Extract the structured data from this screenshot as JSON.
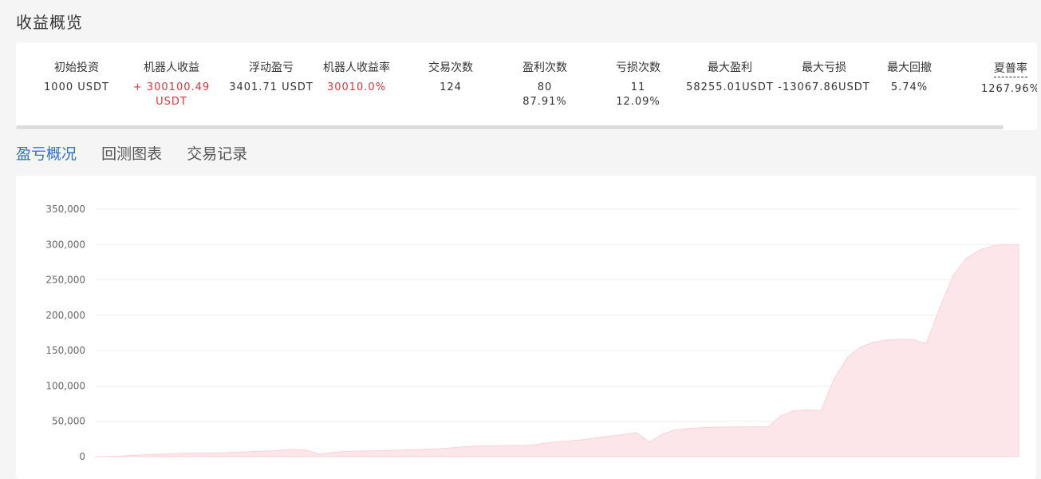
{
  "page": {
    "title": "收益概览"
  },
  "stats": [
    {
      "label": "初始投资",
      "lines": [
        "1000 USDT"
      ],
      "red": false
    },
    {
      "label": "机器人收益",
      "lines": [
        "+ 300100.49",
        "USDT"
      ],
      "red": true
    },
    {
      "label": "浮动盈亏",
      "lines": [
        "3401.71 USDT"
      ],
      "red": false
    },
    {
      "label": "机器人收益率",
      "lines": [
        "30010.0%"
      ],
      "red": true
    },
    {
      "label": "交易次数",
      "lines": [
        "124"
      ],
      "red": false
    },
    {
      "label": "盈利次数",
      "lines": [
        "80",
        "87.91%"
      ],
      "red": false
    },
    {
      "label": "亏损次数",
      "lines": [
        "11",
        "12.09%"
      ],
      "red": false
    },
    {
      "label": "最大盈利",
      "lines": [
        "58255.01USDT"
      ],
      "red": false
    },
    {
      "label": "最大亏损",
      "lines": [
        "-13067.86USDT"
      ],
      "red": false
    },
    {
      "label": "最大回撤",
      "lines": [
        "5.74%"
      ],
      "red": false
    },
    {
      "label": "夏普率",
      "lines": [
        "1267.96%"
      ],
      "red": false
    }
  ],
  "tabs": [
    {
      "label": "盈亏概况",
      "active": true
    },
    {
      "label": "回测图表",
      "active": false
    },
    {
      "label": "交易记录",
      "active": false
    }
  ],
  "colors": {
    "accent": "#2d6fd6",
    "profit_red": "#e0343c",
    "area_fill": "#fde6ea",
    "area_stroke": "#f8d3da"
  },
  "chart_data": {
    "type": "area",
    "title": "",
    "xlabel": "",
    "ylabel": "",
    "ylim": [
      0,
      350000
    ],
    "yticks": [
      "0",
      "50,000",
      "100,000",
      "150,000",
      "200,000",
      "250,000",
      "300,000",
      "350,000"
    ],
    "grid": true,
    "series": [
      {
        "values": [
          0,
          300,
          800,
          2000,
          3000,
          3500,
          4200,
          4800,
          5000,
          5200,
          5600,
          6500,
          7200,
          8000,
          8800,
          10500,
          9000,
          3500,
          6000,
          7500,
          8000,
          8200,
          8600,
          9000,
          9800,
          10400,
          11000,
          12500,
          14000,
          15000,
          15200,
          15500,
          15800,
          16000,
          19000,
          21000,
          22500,
          24000,
          27000,
          29000,
          31000,
          34000,
          21000,
          32000,
          38000,
          40000,
          41000,
          41500,
          42000,
          42000,
          42200,
          42200,
          58000,
          65000,
          66000,
          65000,
          110000,
          140000,
          155000,
          162000,
          165000,
          166000,
          165500,
          160000,
          210000,
          255000,
          280000,
          292000,
          298000,
          300000,
          300100
        ]
      }
    ]
  }
}
